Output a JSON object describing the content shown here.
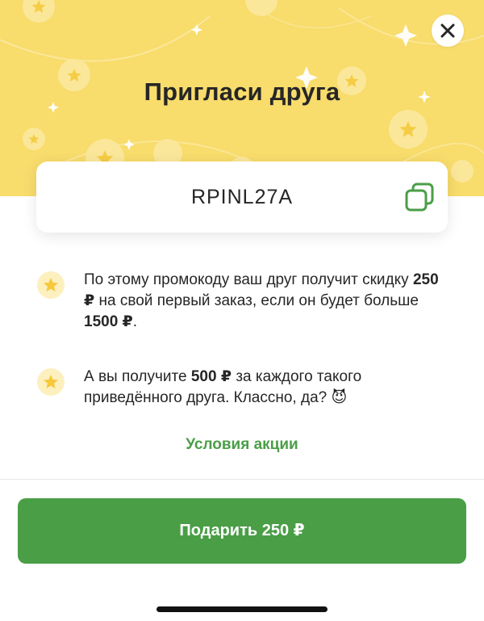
{
  "header": {
    "title": "Пригласи друга",
    "background_color": "#f8dc6c",
    "close_icon": "close-icon"
  },
  "promo": {
    "code": "RPINL27A",
    "copy_icon": "copy-icon"
  },
  "benefits": [
    {
      "icon": "star-icon",
      "parts": [
        {
          "text": "По этому промокоду ваш друг получит скидку ",
          "bold": false
        },
        {
          "text": "250 ₽",
          "bold": true
        },
        {
          "text": " на свой первый заказ, если он будет больше ",
          "bold": false
        },
        {
          "text": "1500 ₽",
          "bold": true
        },
        {
          "text": ".",
          "bold": false
        }
      ]
    },
    {
      "icon": "star-icon",
      "parts": [
        {
          "text": "А вы получите ",
          "bold": false
        },
        {
          "text": "500 ₽",
          "bold": true
        },
        {
          "text": " за каждого такого приведённого друга. Классно, да? ",
          "bold": false
        },
        {
          "text": "😈",
          "bold": false
        }
      ]
    }
  ],
  "conditions_link": "Условия акции",
  "gift_button": "Подарить 250 ₽",
  "colors": {
    "accent_green": "#4a9e46",
    "star_yellow": "#f7c83a",
    "text": "#262626"
  }
}
